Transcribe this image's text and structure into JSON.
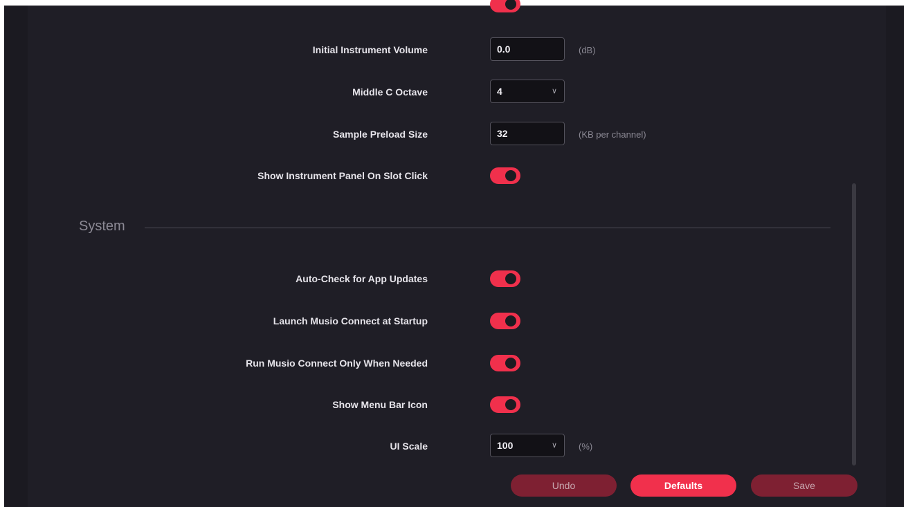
{
  "sections": {
    "system_title": "System"
  },
  "settings": {
    "initial_volume": {
      "label": "Initial Instrument Volume",
      "value": "0.0",
      "unit": "(dB)"
    },
    "middle_c": {
      "label": "Middle C Octave",
      "value": "4"
    },
    "preload": {
      "label": "Sample Preload Size",
      "value": "32",
      "unit": "(KB per channel)"
    },
    "show_panel": {
      "label": "Show Instrument Panel On Slot Click",
      "on": true
    },
    "auto_check": {
      "label": "Auto-Check for App Updates",
      "on": true
    },
    "launch_connect": {
      "label": "Launch Musio Connect at Startup",
      "on": true
    },
    "run_connect": {
      "label": "Run Musio Connect Only When Needed",
      "on": true
    },
    "menu_bar": {
      "label": "Show Menu Bar Icon",
      "on": true
    },
    "ui_scale": {
      "label": "UI Scale",
      "value": "100",
      "unit": "(%)"
    }
  },
  "footer": {
    "undo": "Undo",
    "defaults": "Defaults",
    "save": "Save"
  },
  "colors": {
    "accent": "#f0304c",
    "background": "#1f1e26"
  }
}
